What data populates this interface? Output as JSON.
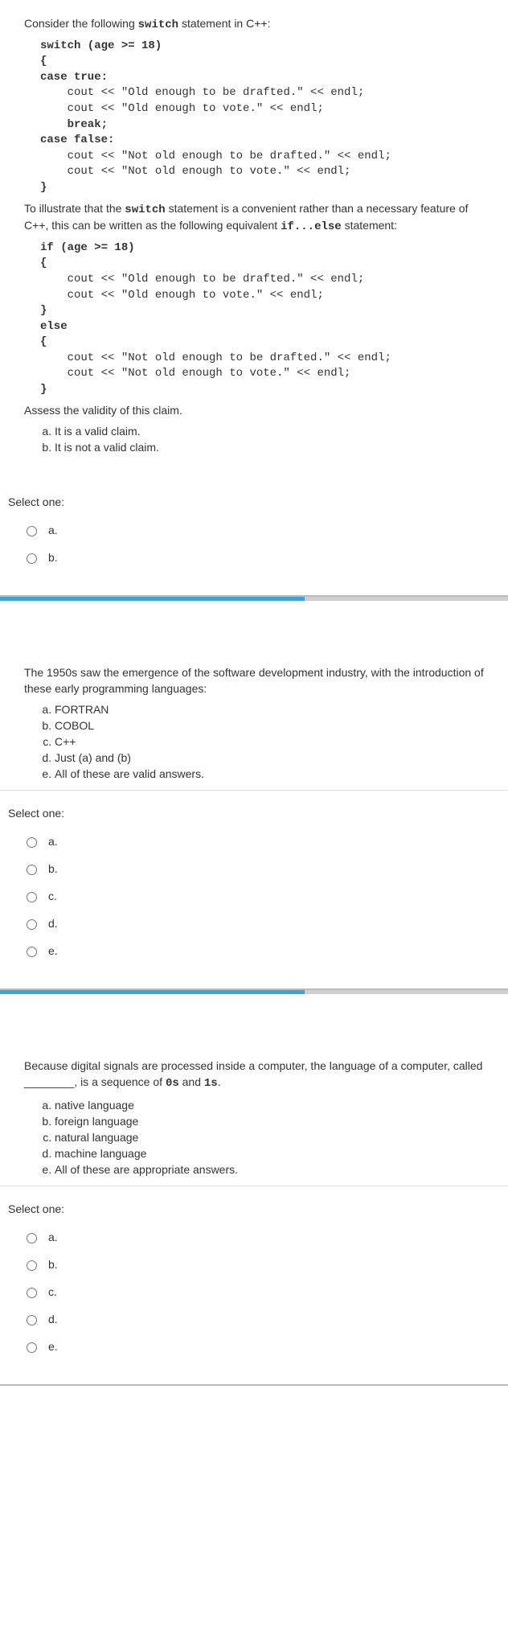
{
  "q1": {
    "intro": "Consider the following ",
    "intro_code": "switch",
    "intro_tail": " statement in C++:",
    "code1_l1": "switch (age >= 18)",
    "code1_l2": "{",
    "code1_l3": "case true:",
    "code1_l4": "    cout << \"Old enough to be drafted.\" << endl;",
    "code1_l5": "    cout << \"Old enough to vote.\" << endl;",
    "code1_l6": "    break;",
    "code1_l7": "case false:",
    "code1_l8": "    cout << \"Not old enough to be drafted.\" << endl;",
    "code1_l9": "    cout << \"Not old enough to vote.\" << endl;",
    "code1_l10": "}",
    "mid1": "To illustrate that the ",
    "mid1_code": "switch",
    "mid1_tail": " statement is a convenient rather than a necessary feature of C++, this can be written as the following equivalent ",
    "mid1_code2": "if...else",
    "mid1_tail2": " statement:",
    "code2_l1": "if (age >= 18)",
    "code2_l2": "{",
    "code2_l3": "    cout << \"Old enough to be drafted.\" << endl;",
    "code2_l4": "    cout << \"Old enough to vote.\" << endl;",
    "code2_l5": "}",
    "code2_l6": "else",
    "code2_l7": "{",
    "code2_l8": "    cout << \"Not old enough to be drafted.\" << endl;",
    "code2_l9": "    cout << \"Not old enough to vote.\" << endl;",
    "code2_l10": "}",
    "assess": "Assess the validity of this claim.",
    "opt_a": "It is a valid claim.",
    "opt_b": "It is not a valid claim.",
    "select": "Select one:",
    "ra": "a.",
    "rb": "b."
  },
  "q2": {
    "text": "The 1950s saw the emergence of the software development industry, with the introduction of these early programming languages:",
    "opt_a": "FORTRAN",
    "opt_b": "COBOL",
    "opt_c": "C++",
    "opt_d": "Just (a) and (b)",
    "opt_e": "All of these are valid answers.",
    "select": "Select one:",
    "ra": "a.",
    "rb": "b.",
    "rc": "c.",
    "rd": "d.",
    "re": "e."
  },
  "q3": {
    "p1": "Because digital signals are processed inside a computer, the language of a computer, called ",
    "blank": "________",
    "p2": ", is a sequence of ",
    "zeros": "0s",
    "p3": " and ",
    "ones": "1s",
    "p4": ".",
    "opt_a": "native language",
    "opt_b": "foreign language",
    "opt_c": "natural language",
    "opt_d": "machine language",
    "opt_e": "All of these are appropriate answers.",
    "select": "Select one:",
    "ra": "a.",
    "rb": "b.",
    "rc": "c.",
    "rd": "d.",
    "re": "e."
  }
}
